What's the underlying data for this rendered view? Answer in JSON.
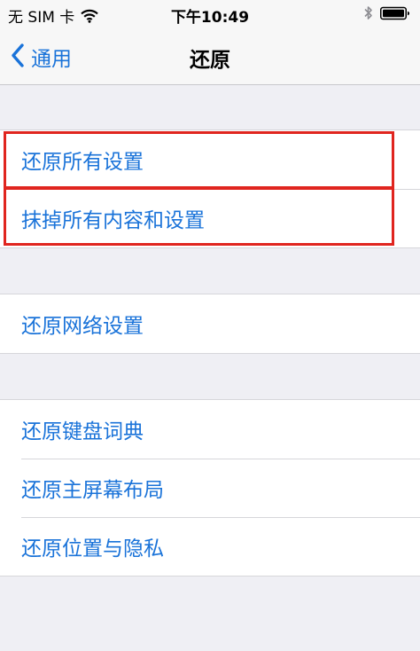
{
  "status_bar": {
    "carrier": "无 SIM 卡",
    "time": "下午10:49",
    "wifi_icon": "wifi-icon",
    "bluetooth_icon": "bluetooth-icon",
    "battery_icon": "battery-icon"
  },
  "nav": {
    "back_label": "通用",
    "title": "还原"
  },
  "groups": [
    {
      "items": [
        {
          "label": "还原所有设置"
        },
        {
          "label": "抹掉所有内容和设置"
        }
      ]
    },
    {
      "items": [
        {
          "label": "还原网络设置"
        }
      ]
    },
    {
      "items": [
        {
          "label": "还原键盘词典"
        },
        {
          "label": "还原主屏幕布局"
        },
        {
          "label": "还原位置与隐私"
        }
      ]
    }
  ],
  "colors": {
    "accent": "#1a73d9",
    "highlight": "#e0251f",
    "background": "#efeff4"
  }
}
